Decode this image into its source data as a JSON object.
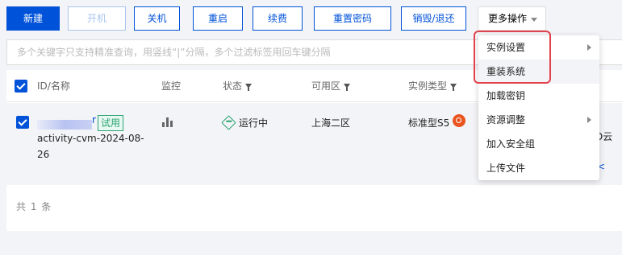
{
  "toolbar": {
    "new_label": "新建",
    "start_label": "开机",
    "shutdown_label": "关机",
    "restart_label": "重启",
    "renew_label": "续费",
    "reset_password_label": "重置密码",
    "destroy_label": "销毁/退还",
    "more_label": "更多操作"
  },
  "search": {
    "placeholder": "多个关键字只支持精准查询，用竖线“|”分隔，多个过滤标签用回车键分隔"
  },
  "table": {
    "columns": {
      "id_name": "ID/名称",
      "monitor": "监控",
      "status": "状态",
      "zone": "可用区",
      "instance_type": "实例类型"
    },
    "rows": [
      {
        "id_suffix": "r",
        "tag": "试用",
        "name": "activity-cvm-2024-08-26",
        "status": "运行中",
        "zone": "上海二区",
        "instance_type": "标准型S5",
        "cut_text": "D云",
        "cut_icon": "<"
      }
    ],
    "footer": "共 1 条"
  },
  "menu": {
    "items": [
      {
        "label": "实例设置",
        "submenu": true
      },
      {
        "label": "重装系统",
        "submenu": false
      },
      {
        "label": "加载密钥",
        "submenu": false
      },
      {
        "label": "资源调整",
        "submenu": true
      },
      {
        "label": "加入安全组",
        "submenu": false
      },
      {
        "label": "上传文件",
        "submenu": false
      }
    ],
    "hovered_item": "重装系统"
  },
  "colors": {
    "primary": "#0052d9",
    "success": "#2ba471",
    "highlight": "#e2404b"
  }
}
